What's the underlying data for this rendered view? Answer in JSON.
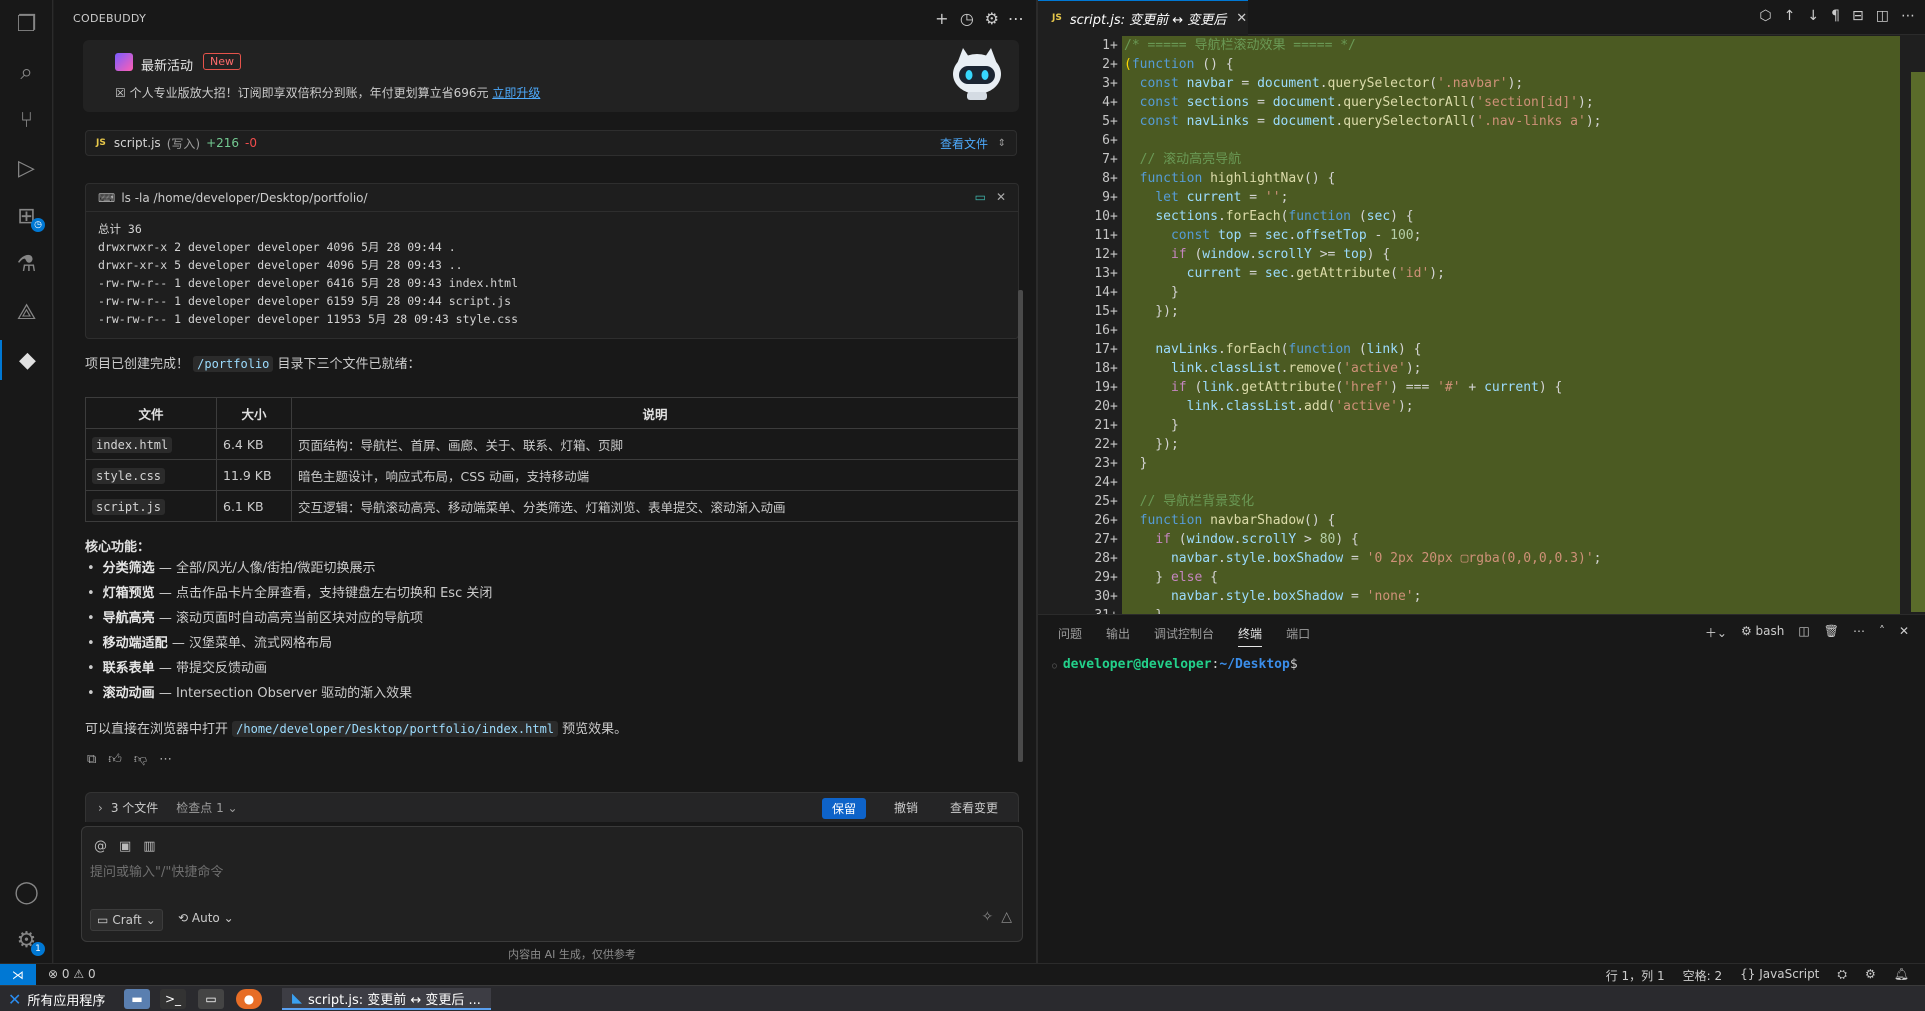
{
  "sidebar": {
    "title": "CODEBUDDY",
    "promo": {
      "title": "最新活动",
      "badge": "New",
      "text": "☒ 个人专业版放大招！订阅即享双倍积分到账，年付更划算立省696元",
      "link": "立即升级"
    },
    "file_chip": {
      "lang": "JS",
      "name": "script.js",
      "mode": "(写入)",
      "added": "+216",
      "removed": "-0",
      "view_label": "查看文件"
    },
    "terminal_block": {
      "command": "ls -la /home/developer/Desktop/portfolio/",
      "lines": [
        "总计 36",
        "drwxrwxr-x 2 developer developer  4096  5月 28 09:44 .",
        "drwxr-xr-x 5 developer developer  4096  5月 28 09:43 ..",
        "-rw-rw-r-- 1 developer developer  6416  5月 28 09:43 index.html",
        "-rw-rw-r-- 1 developer developer  6159  5月 28 09:44 script.js",
        "-rw-rw-r-- 1 developer developer 11953  5月 28 09:43 style.css"
      ]
    },
    "message1": {
      "before": "项目已创建完成！",
      "code": "/portfolio",
      "after": " 目录下三个文件已就绪："
    },
    "table": {
      "headers": [
        "文件",
        "大小",
        "说明"
      ],
      "rows": [
        {
          "file": "index.html",
          "size": "6.4 KB",
          "desc": "页面结构：导航栏、首屏、画廊、关于、联系、灯箱、页脚"
        },
        {
          "file": "style.css",
          "size": "11.9 KB",
          "desc": "暗色主题设计，响应式布局，CSS 动画，支持移动端"
        },
        {
          "file": "script.js",
          "size": "6.1 KB",
          "desc": "交互逻辑：导航滚动高亮、移动端菜单、分类筛选、灯箱浏览、表单提交、滚动渐入动画"
        }
      ]
    },
    "features_title": "核心功能：",
    "features": [
      {
        "name": "分类筛选",
        "desc": " — 全部/风光/人像/街拍/微距切换展示"
      },
      {
        "name": "灯箱预览",
        "desc": " — 点击作品卡片全屏查看，支持键盘左右切换和 Esc 关闭"
      },
      {
        "name": "导航高亮",
        "desc": " — 滚动页面时自动高亮当前区块对应的导航项"
      },
      {
        "name": "移动端适配",
        "desc": " — 汉堡菜单、流式网格布局"
      },
      {
        "name": "联系表单",
        "desc": " — 带提交反馈动画"
      },
      {
        "name": "滚动动画",
        "desc": " — Intersection Observer 驱动的渐入效果"
      }
    ],
    "message2": {
      "before": "可以直接在浏览器中打开 ",
      "code": "/home/developer/Desktop/portfolio/index.html",
      "after": " 预览效果。"
    },
    "changes": {
      "files": "3 个文件",
      "checkpoint": "检查点 1",
      "keep": "保留",
      "undo": "撤销",
      "view": "查看变更"
    },
    "input": {
      "placeholder": "提问或输入\"/\"快捷命令",
      "mode": "Craft",
      "model": "Auto"
    },
    "disclaimer": "内容由 AI 生成，仅供参考"
  },
  "editor": {
    "tab_lang": "JS",
    "tab_title": "script.js: 变更前 ↔ 变更后"
  },
  "panel": {
    "tabs": [
      "问题",
      "输出",
      "调试控制台",
      "终端",
      "端口"
    ],
    "active_tab": "终端",
    "shell": "bash",
    "prompt_user": "developer@developer",
    "prompt_path": "~/Desktop"
  },
  "statusbar": {
    "errors": "0",
    "warnings": "0",
    "position": "行 1，列 1",
    "spaces": "空格: 2",
    "language": "JavaScript"
  },
  "taskbar": {
    "start_label": "所有应用程序",
    "window_title": "script.js: 变更前 ↔ 变更后 ..."
  },
  "activity_badges": {
    "extensions": "",
    "settings": "1"
  }
}
